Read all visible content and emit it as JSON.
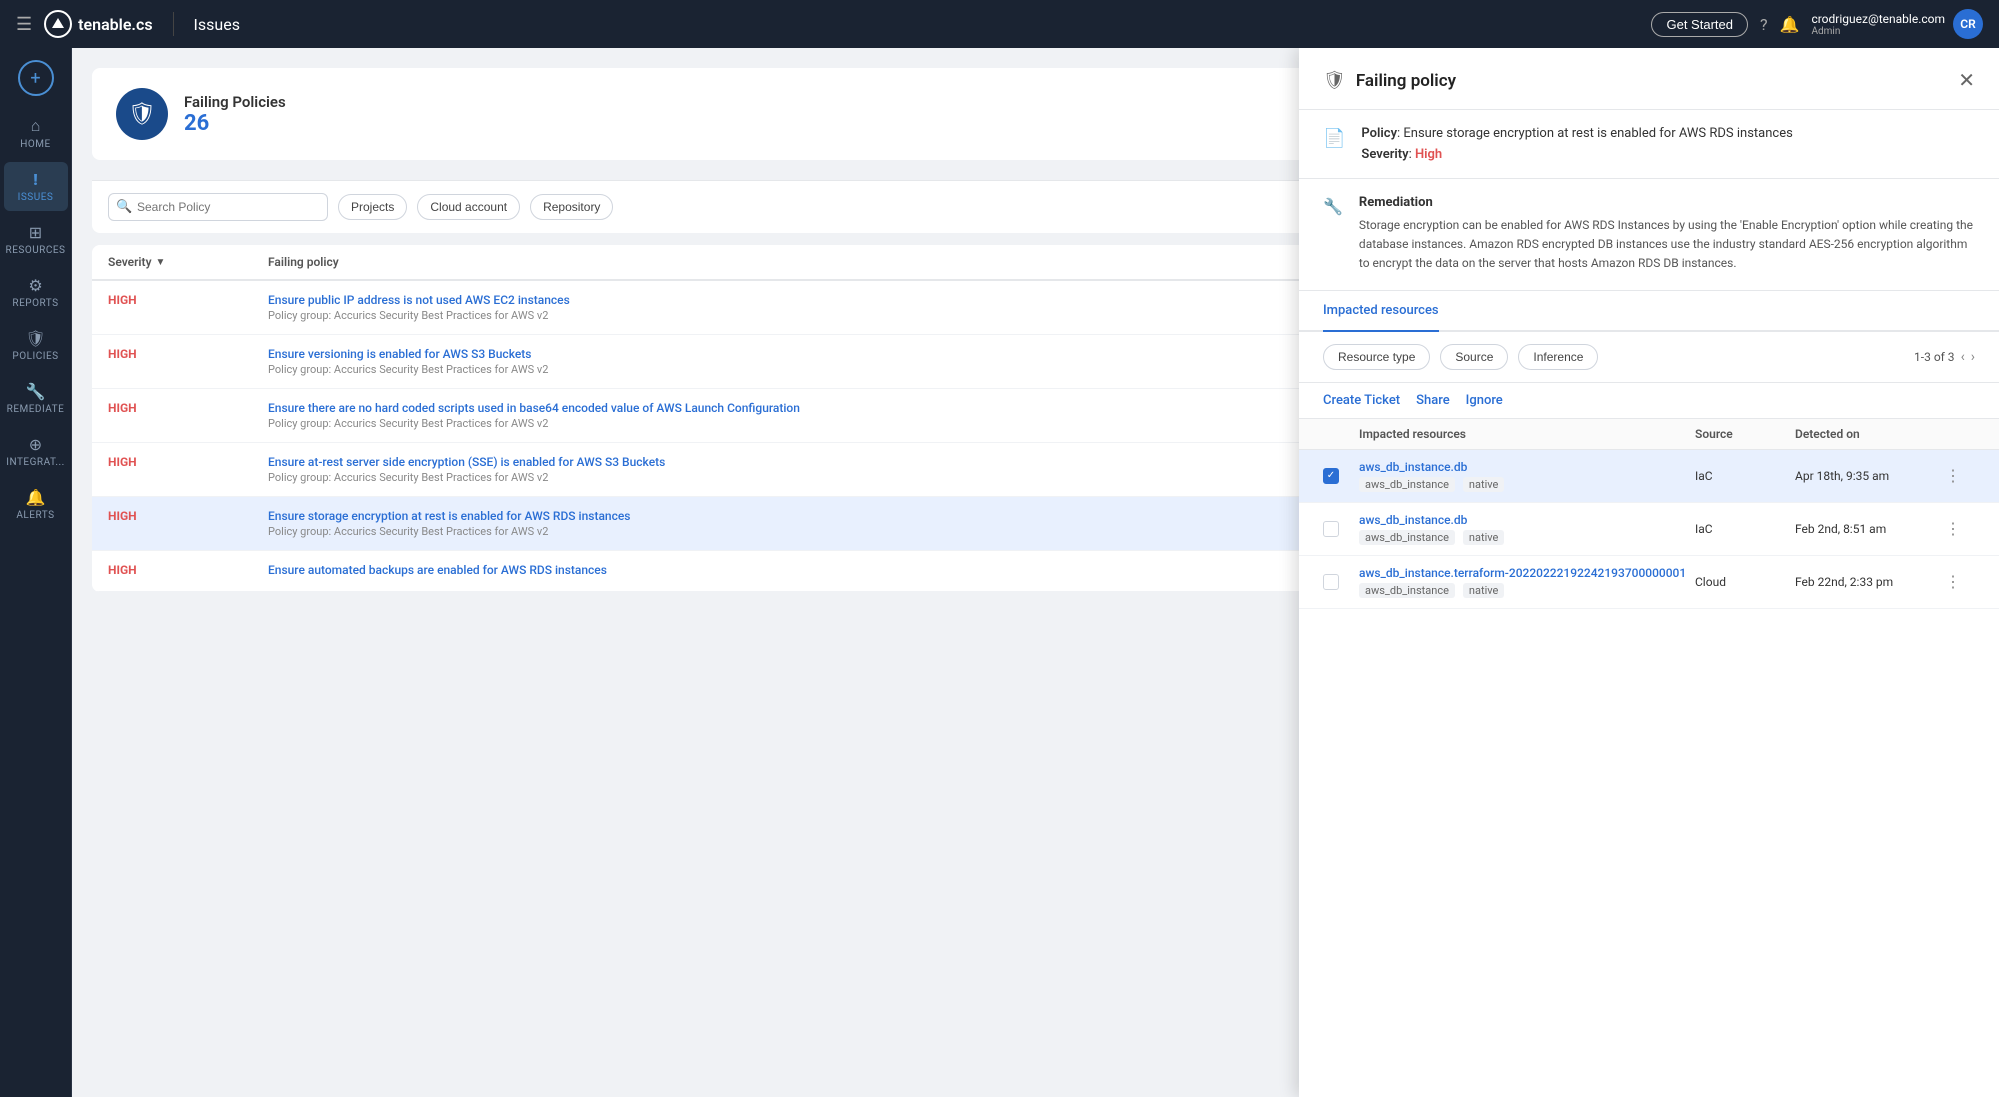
{
  "app": {
    "logo_text": "tenable.cs",
    "page_title": "Issues",
    "get_started_label": "Get Started",
    "user_email": "crodriguez@tenable.com",
    "user_role": "Admin",
    "user_initials": "CR"
  },
  "sidebar": {
    "add_icon": "+",
    "items": [
      {
        "id": "home",
        "label": "HOME",
        "icon": "⌂",
        "active": false
      },
      {
        "id": "issues",
        "label": "ISSUES",
        "icon": "!",
        "active": true
      },
      {
        "id": "resources",
        "label": "RESOURCES",
        "icon": "⊞",
        "active": false
      },
      {
        "id": "reports",
        "label": "REPORTS",
        "icon": "⚙",
        "active": false
      },
      {
        "id": "policies",
        "label": "POLICIES",
        "icon": "🛡",
        "active": false
      },
      {
        "id": "remediate",
        "label": "REMEDIATE",
        "icon": "🔧",
        "active": false
      },
      {
        "id": "integrations",
        "label": "INTEGRAT...",
        "icon": "⊕",
        "active": false
      },
      {
        "id": "alerts",
        "label": "ALERTS",
        "icon": "🔔",
        "active": false
      }
    ]
  },
  "failing_policies": {
    "title": "Failing Policies",
    "count": "26"
  },
  "filters": {
    "search_placeholder": "Search Policy",
    "buttons": [
      "Projects",
      "Cloud account",
      "Repository"
    ]
  },
  "table": {
    "columns": [
      "Severity",
      "Failing policy"
    ],
    "rows": [
      {
        "severity": "HIGH",
        "policy_name": "Ensure public IP address is not used AWS EC2 instances",
        "policy_group": "Policy group: Accurics Security Best Practices for AWS v2",
        "selected": false
      },
      {
        "severity": "HIGH",
        "policy_name": "Ensure versioning is enabled for AWS S3 Buckets",
        "policy_group": "Policy group: Accurics Security Best Practices for AWS v2",
        "selected": false
      },
      {
        "severity": "HIGH",
        "policy_name": "Ensure there are no hard coded scripts used in base64 encoded value of AWS Launch Configuration",
        "policy_group": "Policy group: Accurics Security Best Practices for AWS v2",
        "selected": false
      },
      {
        "severity": "HIGH",
        "policy_name": "Ensure at-rest server side encryption (SSE) is enabled for AWS S3 Buckets",
        "policy_group": "Policy group: Accurics Security Best Practices for AWS v2",
        "selected": false
      },
      {
        "severity": "HIGH",
        "policy_name": "Ensure storage encryption at rest is enabled for AWS RDS instances",
        "policy_group": "Policy group: Accurics Security Best Practices for AWS v2",
        "selected": true
      },
      {
        "severity": "HIGH",
        "policy_name": "Ensure automated backups are enabled for AWS RDS instances",
        "policy_group": "",
        "selected": false
      }
    ]
  },
  "detail_panel": {
    "title": "Failing policy",
    "policy_label": "Policy",
    "policy_value": "Ensure storage encryption at rest is enabled for AWS RDS instances",
    "severity_label": "Severity",
    "severity_value": "High",
    "remediation_label": "Remediation",
    "remediation_text": "Storage encryption can be enabled for AWS RDS Instances by using the 'Enable Encryption' option while creating the database instances. Amazon RDS encrypted DB instances use the industry standard AES-256 encryption algorithm to encrypt the data on the server that hosts Amazon RDS DB instances.",
    "tabs": [
      {
        "id": "impacted",
        "label": "Impacted resources",
        "active": true
      }
    ],
    "filter_buttons": [
      "Resource type",
      "Source",
      "Inference"
    ],
    "pagination": "1-3 of 3",
    "actions": [
      "Create Ticket",
      "Share",
      "Ignore"
    ],
    "table_columns": [
      "Impacted resources",
      "Source",
      "Detected on"
    ],
    "resources": [
      {
        "name": "aws_db_instance.db",
        "tags": [
          "aws_db_instance",
          "native"
        ],
        "source": "IaC",
        "detected": "Apr 18th, 9:35 am",
        "checked": true
      },
      {
        "name": "aws_db_instance.db",
        "tags": [
          "aws_db_instance",
          "native"
        ],
        "source": "IaC",
        "detected": "Feb 2nd, 8:51 am",
        "checked": false
      },
      {
        "name": "aws_db_instance.terraform-20220222192242193700000001",
        "tags": [
          "aws_db_instance",
          "native"
        ],
        "source": "Cloud",
        "detected": "Feb 22nd, 2:33 pm",
        "checked": false
      }
    ]
  }
}
